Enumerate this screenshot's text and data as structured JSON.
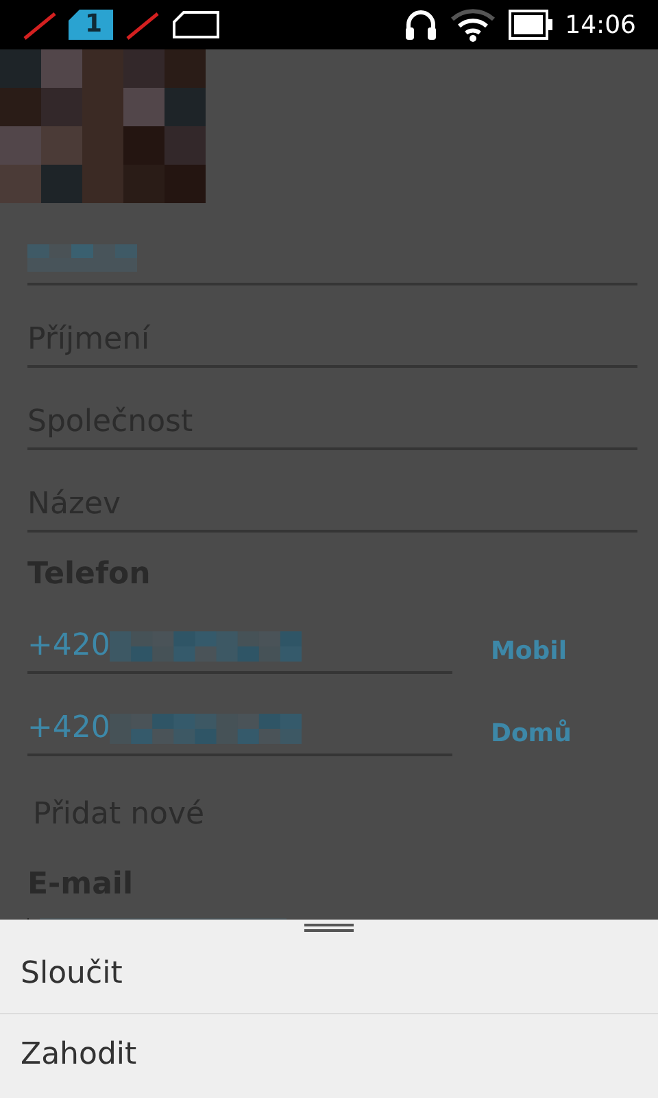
{
  "status_bar": {
    "sim_slot": "1",
    "time": "14:06"
  },
  "contact_form": {
    "fields": [
      {
        "kind": "redacted"
      },
      {
        "kind": "text",
        "placeholder": "Příjmení"
      },
      {
        "kind": "text",
        "placeholder": "Společnost"
      },
      {
        "kind": "text",
        "placeholder": "Název"
      }
    ],
    "phone_section": {
      "title": "Telefon",
      "numbers": [
        {
          "value": "+420",
          "type": "Mobil"
        },
        {
          "value": "+420",
          "type": "Domů"
        }
      ],
      "add_new": "Přidat nové"
    },
    "email_section": {
      "title": "E-mail"
    }
  },
  "menu": {
    "items": [
      "Sloučit",
      "Zahodit"
    ]
  }
}
